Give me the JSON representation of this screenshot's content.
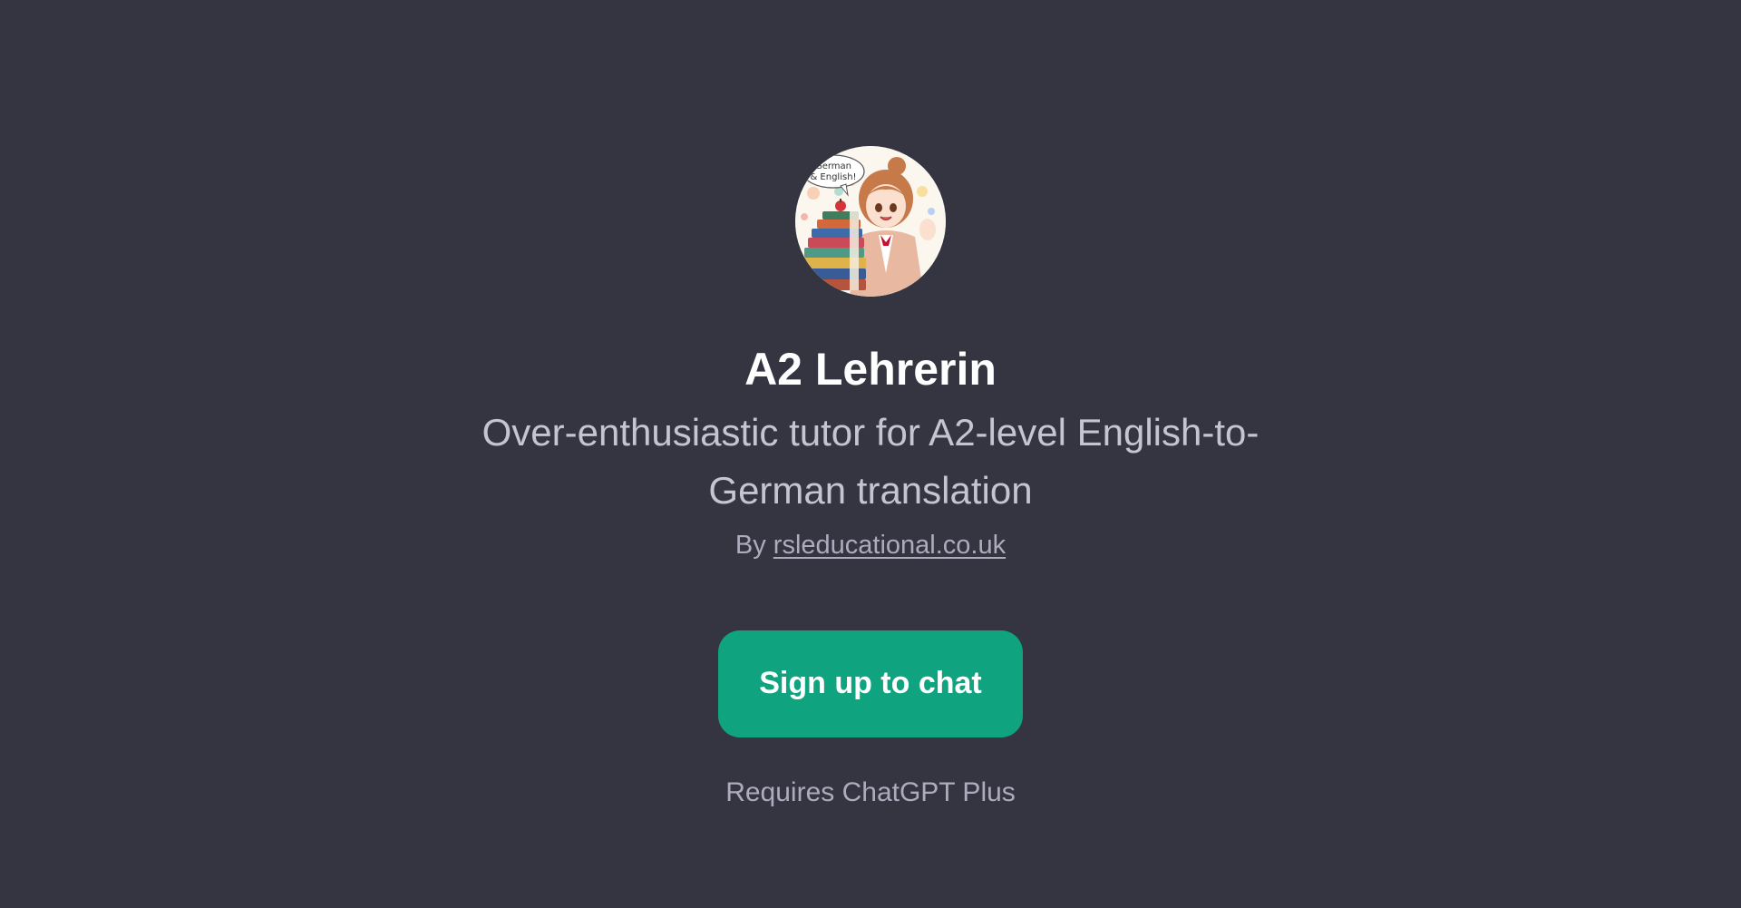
{
  "gpt": {
    "avatar": {
      "icon": "tutor-avatar-illustration",
      "speech_bubble_line1": "German",
      "speech_bubble_line2": "& English!"
    },
    "title": "A2 Lehrerin",
    "description": "Over-enthusiastic tutor for A2-level English-to-German translation",
    "byline_prefix": "By",
    "author": "rsleducational.co.uk"
  },
  "actions": {
    "signup_label": "Sign up to chat",
    "requirement_note": "Requires ChatGPT Plus"
  },
  "colors": {
    "background": "#343541",
    "accent": "#10a37f",
    "title": "#ffffff",
    "subtitle": "#c5c5d2",
    "muted": "#acacbe"
  }
}
